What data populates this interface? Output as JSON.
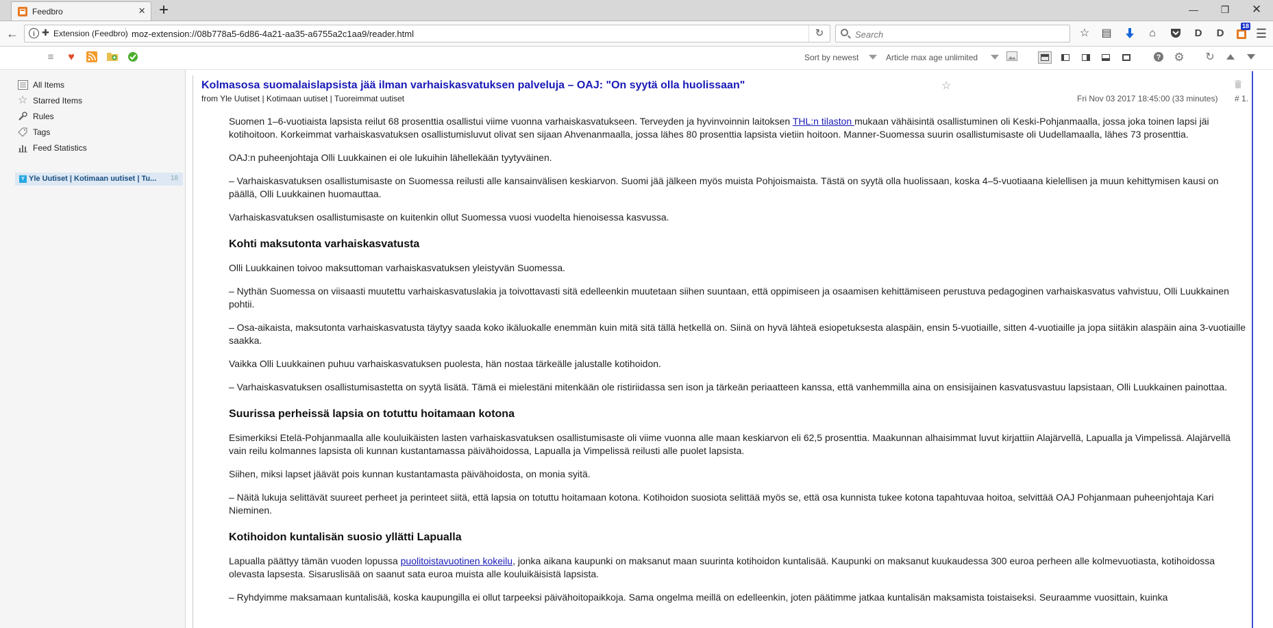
{
  "browser": {
    "tab_title": "Feedbro",
    "url_identity": "Extension (Feedbro)",
    "url": "moz-extension://08b778a5-6d86-4a21-aa35-a6755a2c1aa9/reader.html",
    "search_placeholder": "Search",
    "notification_badge": "18",
    "download_arrow_color": "#1565d8"
  },
  "toolbar": {
    "sort_label": "Sort by newest",
    "max_age_label": "Article max age unlimited"
  },
  "sidebar": {
    "items": [
      {
        "label": "All Items",
        "icon": "all-items-icon"
      },
      {
        "label": "Starred Items",
        "icon": "star-icon"
      },
      {
        "label": "Rules",
        "icon": "wrench-icon"
      },
      {
        "label": "Tags",
        "icon": "tag-icon"
      },
      {
        "label": "Feed Statistics",
        "icon": "chart-icon"
      }
    ],
    "feed": {
      "label": "Yle Uutiset | Kotimaan uutiset | Tu...",
      "count": "18"
    }
  },
  "article": {
    "title": "Kolmasosa suomalaislapsista jää ilman varhaiskasvatuksen palveluja – OAJ: \"On syytä olla huolissaan\"",
    "source": "from Yle Uutiset | Kotimaan uutiset | Tuoreimmat uutiset",
    "date": "Fri Nov 03 2017 18:45:00 (33 minutes)",
    "number": "# 1.",
    "p1_a": "Suomen 1–6-vuotiaista lapsista reilut 68 prosenttia osallistui viime vuonna varhaiskasvatukseen. Terveyden ja hyvinvoinnin laitoksen ",
    "p1_link": "THL:n tilaston ",
    "p1_b": "mukaan vähäisintä osallistuminen oli Keski-Pohjanmaalla, jossa joka toinen lapsi jäi kotihoitoon. Korkeimmat varhaiskasvatuksen osallistumisluvut olivat sen sijaan Ahvenanmaalla, jossa lähes 80 prosenttia lapsista vietiin hoitoon. Manner-Suomessa suurin osallistumisaste oli Uudellamaalla, lähes 73 prosenttia.",
    "p2": "OAJ:n puheenjohtaja Olli Luukkainen ei ole lukuihin lähellekään tyytyväinen.",
    "p3": "– Varhaiskasvatuksen osallistumisaste on Suomessa reilusti alle kansainvälisen keskiarvon. Suomi jää jälkeen myös muista Pohjoismaista. Tästä on syytä olla huolissaan, koska 4–5-vuotiaana kielellisen ja muun kehittymisen kausi on päällä, Olli Luukkainen huomauttaa.",
    "p4": "Varhaiskasvatuksen osallistumisaste on kuitenkin ollut Suomessa vuosi vuodelta hienoisessa kasvussa.",
    "h1": "Kohti maksutonta varhaiskasvatusta",
    "p5": "Olli Luukkainen toivoo maksuttoman varhaiskasvatuksen yleistyvän Suomessa.",
    "p6": "– Nythän Suomessa on viisaasti muutettu varhaiskasvatuslakia ja toivottavasti sitä edelleenkin muutetaan siihen suuntaan, että oppimiseen ja osaamisen kehittämiseen perustuva pedagoginen varhaiskasvatus vahvistuu, Olli Luukkainen pohtii.",
    "p7": "– Osa-aikaista, maksutonta varhaiskasvatusta täytyy saada koko ikäluokalle enemmän kuin mitä sitä tällä hetkellä on. Siinä on hyvä lähteä esiopetuksesta alaspäin, ensin 5-vuotiaille, sitten 4-vuotiaille ja jopa siitäkin alaspäin aina 3-vuotiaille saakka.",
    "p8": "Vaikka Olli Luukkainen puhuu varhaiskasvatuksen puolesta, hän nostaa tärkeälle jalustalle kotihoidon.",
    "p9": "– Varhaiskasvatuksen osallistumisastetta on syytä lisätä. Tämä ei mielestäni mitenkään ole ristiriidassa sen ison ja tärkeän periaatteen kanssa, että vanhemmilla aina on ensisijainen kasvatusvastuu lapsistaan, Olli Luukkainen painottaa.",
    "h2": "Suurissa perheissä lapsia on totuttu hoitamaan kotona",
    "p10": "Esimerkiksi Etelä-Pohjanmaalla alle kouluikäisten lasten varhaiskasvatuksen osallistumisaste oli viime vuonna alle maan keskiarvon eli 62,5 prosenttia. Maakunnan alhaisimmat luvut kirjattiin Alajärvellä, Lapualla ja Vimpelissä. Alajärvellä vain reilu kolmannes lapsista oli kunnan kustantamassa päivähoidossa, Lapualla ja Vimpelissä reilusti alle puolet lapsista.",
    "p11": "Siihen, miksi lapset jäävät pois kunnan kustantamasta päivähoidosta, on monia syitä.",
    "p12": "– Näitä lukuja selittävät suureet perheet ja perinteet siitä, että lapsia on totuttu hoitamaan kotona. Kotihoidon suosiota selittää myös se, että osa kunnista tukee kotona tapahtuvaa hoitoa, selvittää OAJ Pohjanmaan puheenjohtaja Kari Nieminen.",
    "h3": "Kotihoidon kuntalisän suosio yllätti Lapualla",
    "p13_a": "Lapualla päättyy tämän vuoden lopussa ",
    "p13_link": "puolitoistavuotinen kokeilu",
    "p13_b": ", jonka aikana kaupunki on maksanut maan suurinta kotihoidon kuntalisää. Kaupunki on maksanut kuukaudessa 300 euroa perheen alle kolmevuotiasta, kotihoidossa olevasta lapsesta. Sisaruslisää on saanut sata euroa muista alle kouluikäisistä lapsista.",
    "p14": "– Ryhdyimme maksamaan kuntalisää, koska kaupungilla ei ollut tarpeeksi päivähoitopaikkoja. Sama ongelma meillä on edelleenkin, joten päätimme jatkaa kuntalisän maksamista toistaiseksi. Seuraamme vuosittain, kuinka"
  }
}
